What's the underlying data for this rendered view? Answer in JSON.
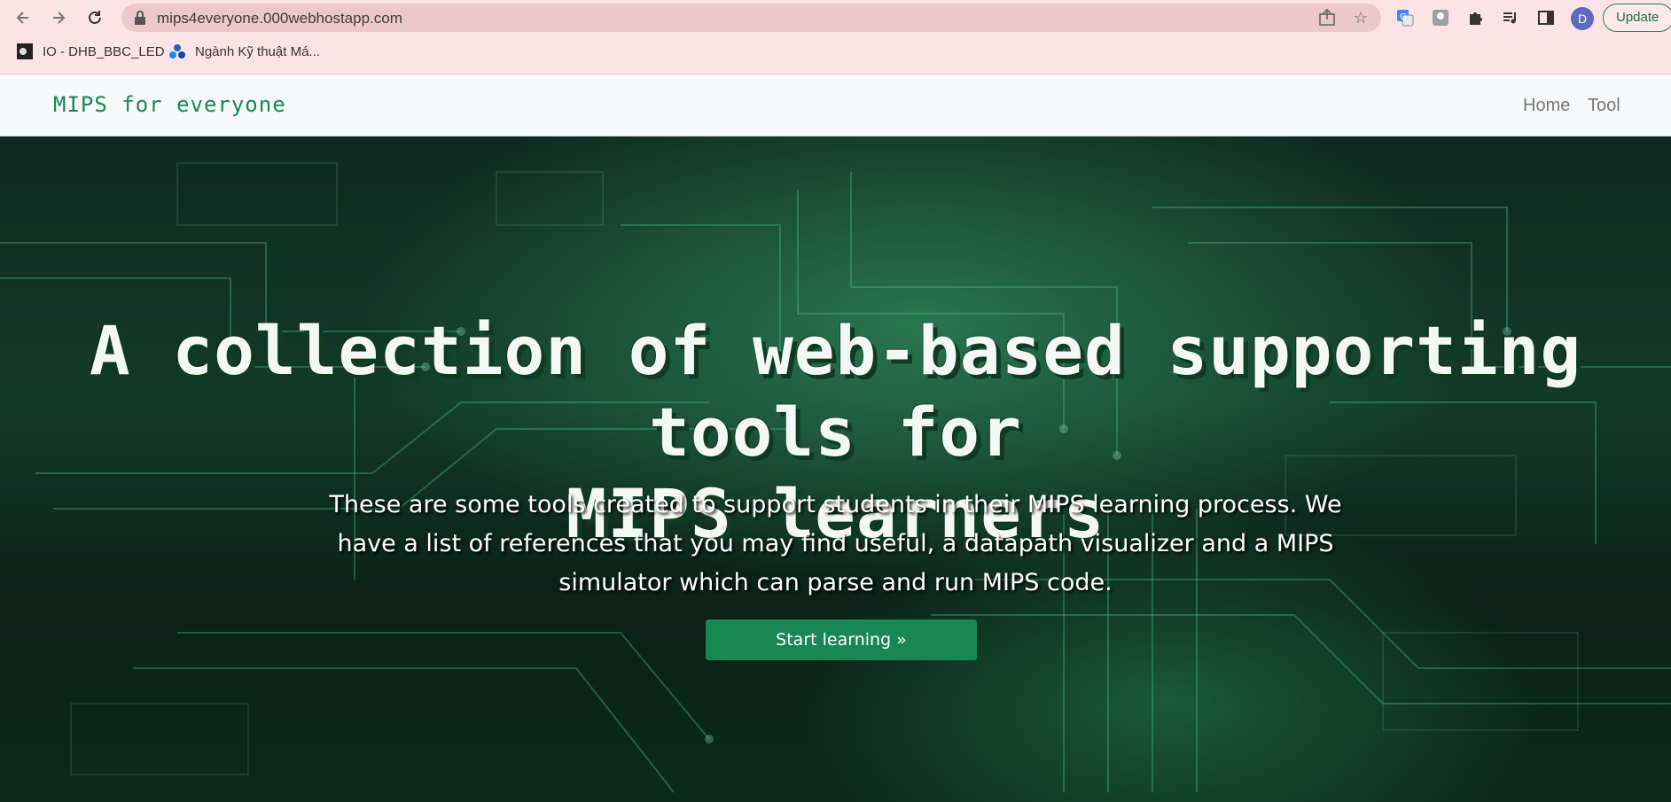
{
  "browser": {
    "url": "mips4everyone.000webhostapp.com",
    "avatar_letter": "D",
    "update_label": "Update",
    "bookmarks": [
      {
        "label": "IO - DHB_BBC_LED"
      },
      {
        "label": "Ngành Kỹ thuật Má..."
      }
    ]
  },
  "site": {
    "brand": "MIPS for everyone",
    "nav": [
      {
        "label": "Home"
      },
      {
        "label": "Tool"
      }
    ]
  },
  "hero": {
    "title_line1": "A collection of web-based supporting tools for",
    "title_line2": "MIPS learners",
    "subtitle_line1": "These are some tools created to support students in their MIPS learning process. We",
    "subtitle_line2": "have a list of references that you may find useful, a datapath visualizer and a MIPS",
    "subtitle_line3": "simulator which can parse and run MIPS code.",
    "cta_label": "Start learning »"
  },
  "colors": {
    "brand": "#198754",
    "chrome_bg": "#fce4e6",
    "omnibox_bg": "#ecc8cb"
  }
}
